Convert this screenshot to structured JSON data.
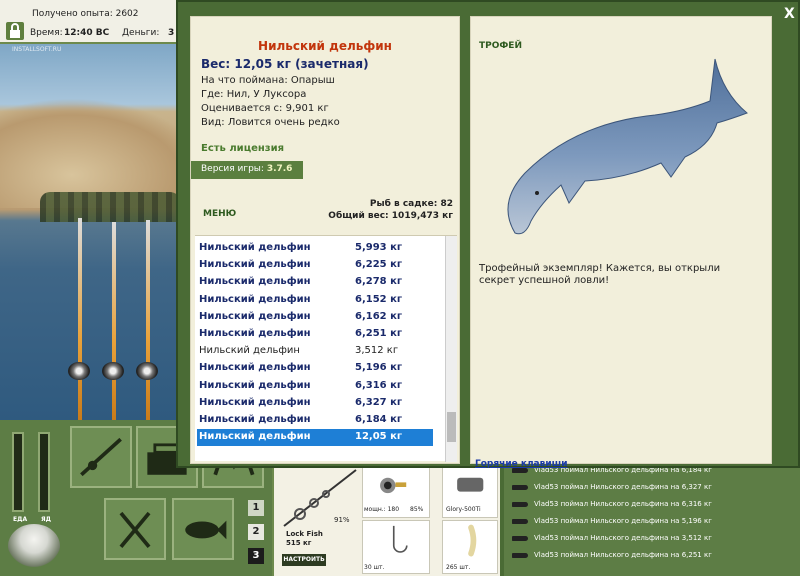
{
  "status": {
    "xp_label": "Получено опыта: 2602",
    "time_label": "Время:",
    "time_value": "12:40 ВС",
    "money_label": "Деньги:",
    "money_value": "3"
  },
  "scene": {
    "watermark": "INSTALLSOFT.RU"
  },
  "bars": {
    "food_label": "ЕДА",
    "poison_label": "ЯД"
  },
  "panel_numbers": [
    "1",
    "2",
    "3"
  ],
  "tackle": {
    "lock_fish": "Lock Fish",
    "lock_fish_value": "515 кг",
    "rod_percent": "91%",
    "setup_button": "НАСТРОИТЬ",
    "reel_power": "мощн.: 180",
    "reel_percent": "85%",
    "line_name": "Glory-500Ti",
    "hooks_count": "30 шт.",
    "bait_count": "265 шт."
  },
  "chat": [
    "Vlad53 поймал Нильского дельфина на 6,184 кг",
    "Vlad53 поймал Нильского дельфина на 6,327 кг",
    "Vlad53 поймал Нильского дельфина на 6,316 кг",
    "Vlad53 поймал Нильского дельфина на 5,196 кг",
    "Vlad53 поймал Нильского дельфина на 3,512 кг",
    "Vlad53 поймал Нильского дельфина на 6,251 кг"
  ],
  "dialog": {
    "close": "X",
    "fish_title": "Нильский дельфин",
    "fish_weight": "Вес: 12,05 кг (зачетная)",
    "caught_on": "На что поймана: Опарыш",
    "location": "Где: Нил, У Луксора",
    "valued_from": "Оценивается с: 9,901 кг",
    "species": "Вид: Ловится очень редко",
    "license": "Есть лицензия",
    "version_label": "Версия игры:",
    "version_value": "3.7.6",
    "menu": "МЕНЮ",
    "keep_count": "Рыб в садке: 82",
    "total_weight": "Общий вес: 1019,473 кг",
    "trophy_title": "ТРОФЕЙ",
    "trophy_text": "Трофейный экземпляр! Кажется, вы открыли секрет успешной ловли!",
    "hotkeys": "Горячие клавиши"
  },
  "fish_list": [
    {
      "name": "Нильский дельфин",
      "weight": "5,993 кг",
      "style": "bold"
    },
    {
      "name": "Нильский дельфин",
      "weight": "6,225 кг",
      "style": "bold"
    },
    {
      "name": "Нильский дельфин",
      "weight": "6,278 кг",
      "style": "bold"
    },
    {
      "name": "Нильский дельфин",
      "weight": "6,152 кг",
      "style": "bold"
    },
    {
      "name": "Нильский дельфин",
      "weight": "6,162 кг",
      "style": "bold"
    },
    {
      "name": "Нильский дельфин",
      "weight": "6,251 кг",
      "style": "bold"
    },
    {
      "name": "Нильский дельфин",
      "weight": "3,512 кг",
      "style": "normal"
    },
    {
      "name": "Нильский дельфин",
      "weight": "5,196 кг",
      "style": "bold"
    },
    {
      "name": "Нильский дельфин",
      "weight": "6,316 кг",
      "style": "bold"
    },
    {
      "name": "Нильский дельфин",
      "weight": "6,327 кг",
      "style": "bold"
    },
    {
      "name": "Нильский дельфин",
      "weight": "6,184 кг",
      "style": "bold"
    },
    {
      "name": "Нильский дельфин",
      "weight": "12,05 кг",
      "style": "selected"
    }
  ],
  "colors": {
    "accent_green": "#4a6b35",
    "title_red": "#c2350c",
    "selected_blue": "#1e7fd6",
    "fish_name_navy": "#1a2a6b"
  },
  "icons": [
    "lock-icon",
    "rod-icon",
    "tackle-box-icon",
    "cutlery-icon",
    "fish-icon",
    "bait-pot-icon"
  ]
}
